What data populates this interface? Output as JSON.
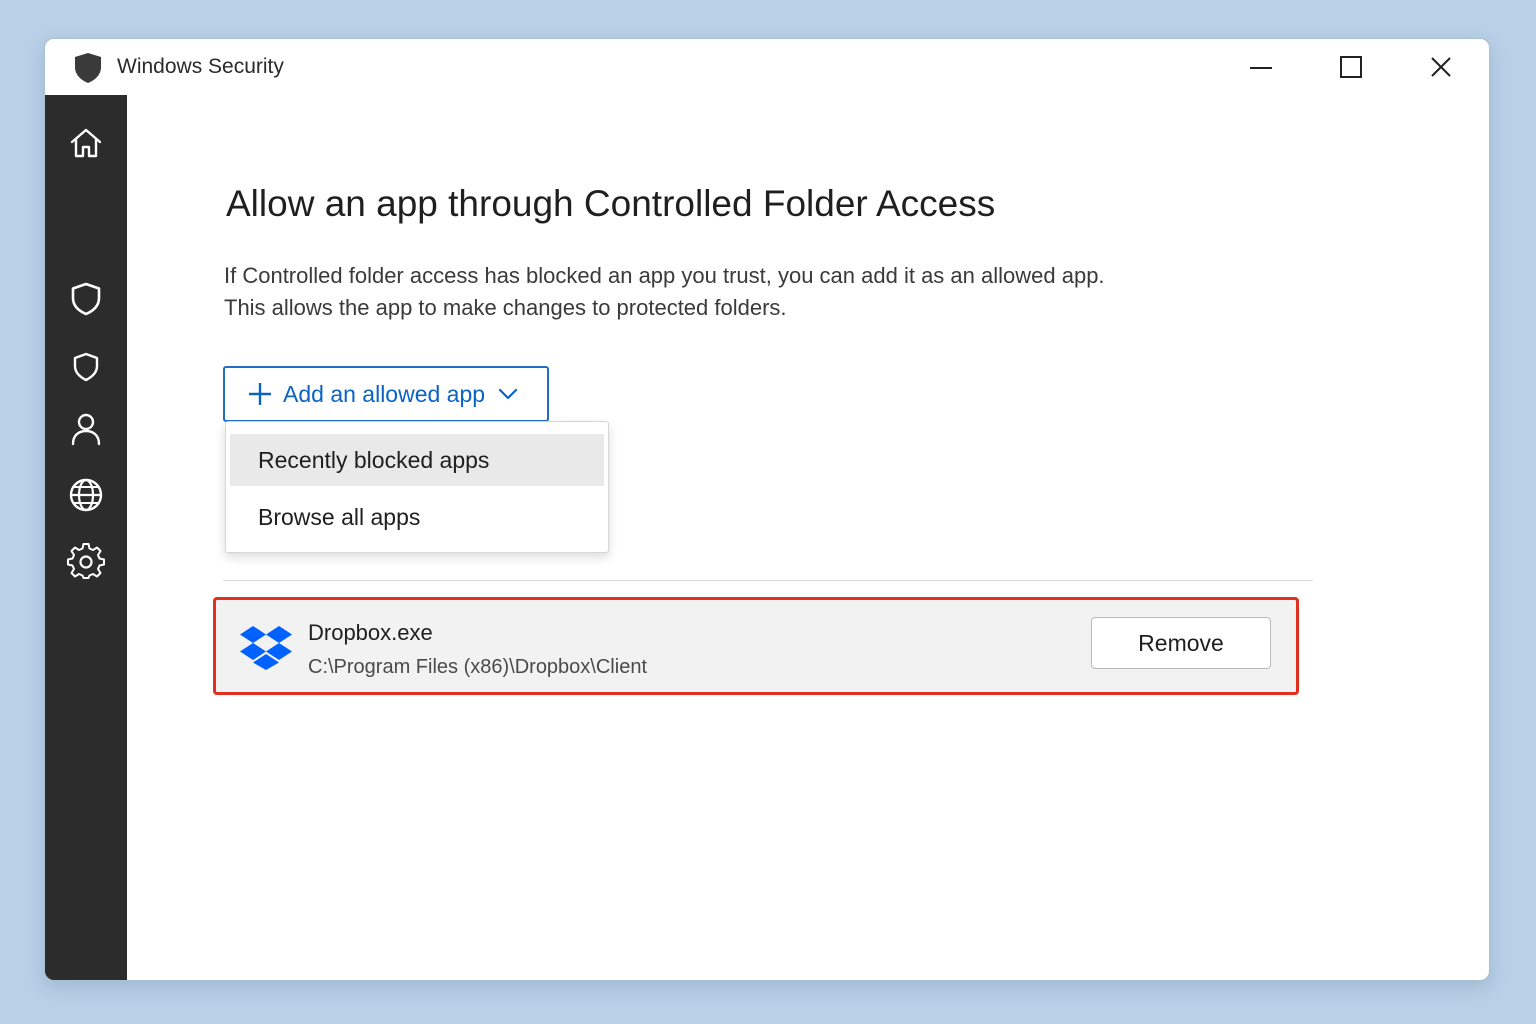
{
  "window": {
    "title": "Windows Security",
    "controls": {
      "minimize_icon": "minimize-icon",
      "maximize_icon": "maximize-icon",
      "close_icon": "close-icon"
    }
  },
  "sidebar": {
    "items": [
      {
        "icon": "home-icon"
      },
      {
        "icon": "shield-icon"
      },
      {
        "icon": "shield-outline-icon"
      },
      {
        "icon": "person-icon"
      },
      {
        "icon": "globe-icon"
      },
      {
        "icon": "gear-icon"
      }
    ]
  },
  "main": {
    "title": "Allow an app through Controlled Folder Access",
    "description_line1": "If Controlled folder access has blocked an app you trust, you can add it as an allowed app.",
    "description_line2": "This allows the app to make changes to protected folders.",
    "add_button_label": "Add an allowed app",
    "dropdown": {
      "items": [
        {
          "label": "Recently blocked apps",
          "hovered": true
        },
        {
          "label": "Browse all apps",
          "hovered": false
        }
      ]
    },
    "allowed_apps": [
      {
        "name": "Dropbox.exe",
        "path": "C:\\Program Files (x86)\\Dropbox\\Client",
        "icon": "dropbox-icon",
        "action_label": "Remove"
      }
    ]
  },
  "colors": {
    "accent": "#0b63c4",
    "sidebar_bg": "#2c2c2c",
    "highlight_border": "#e0301e",
    "dropbox_blue": "#0061fe",
    "desktop_bg": "#b9d1e7"
  }
}
